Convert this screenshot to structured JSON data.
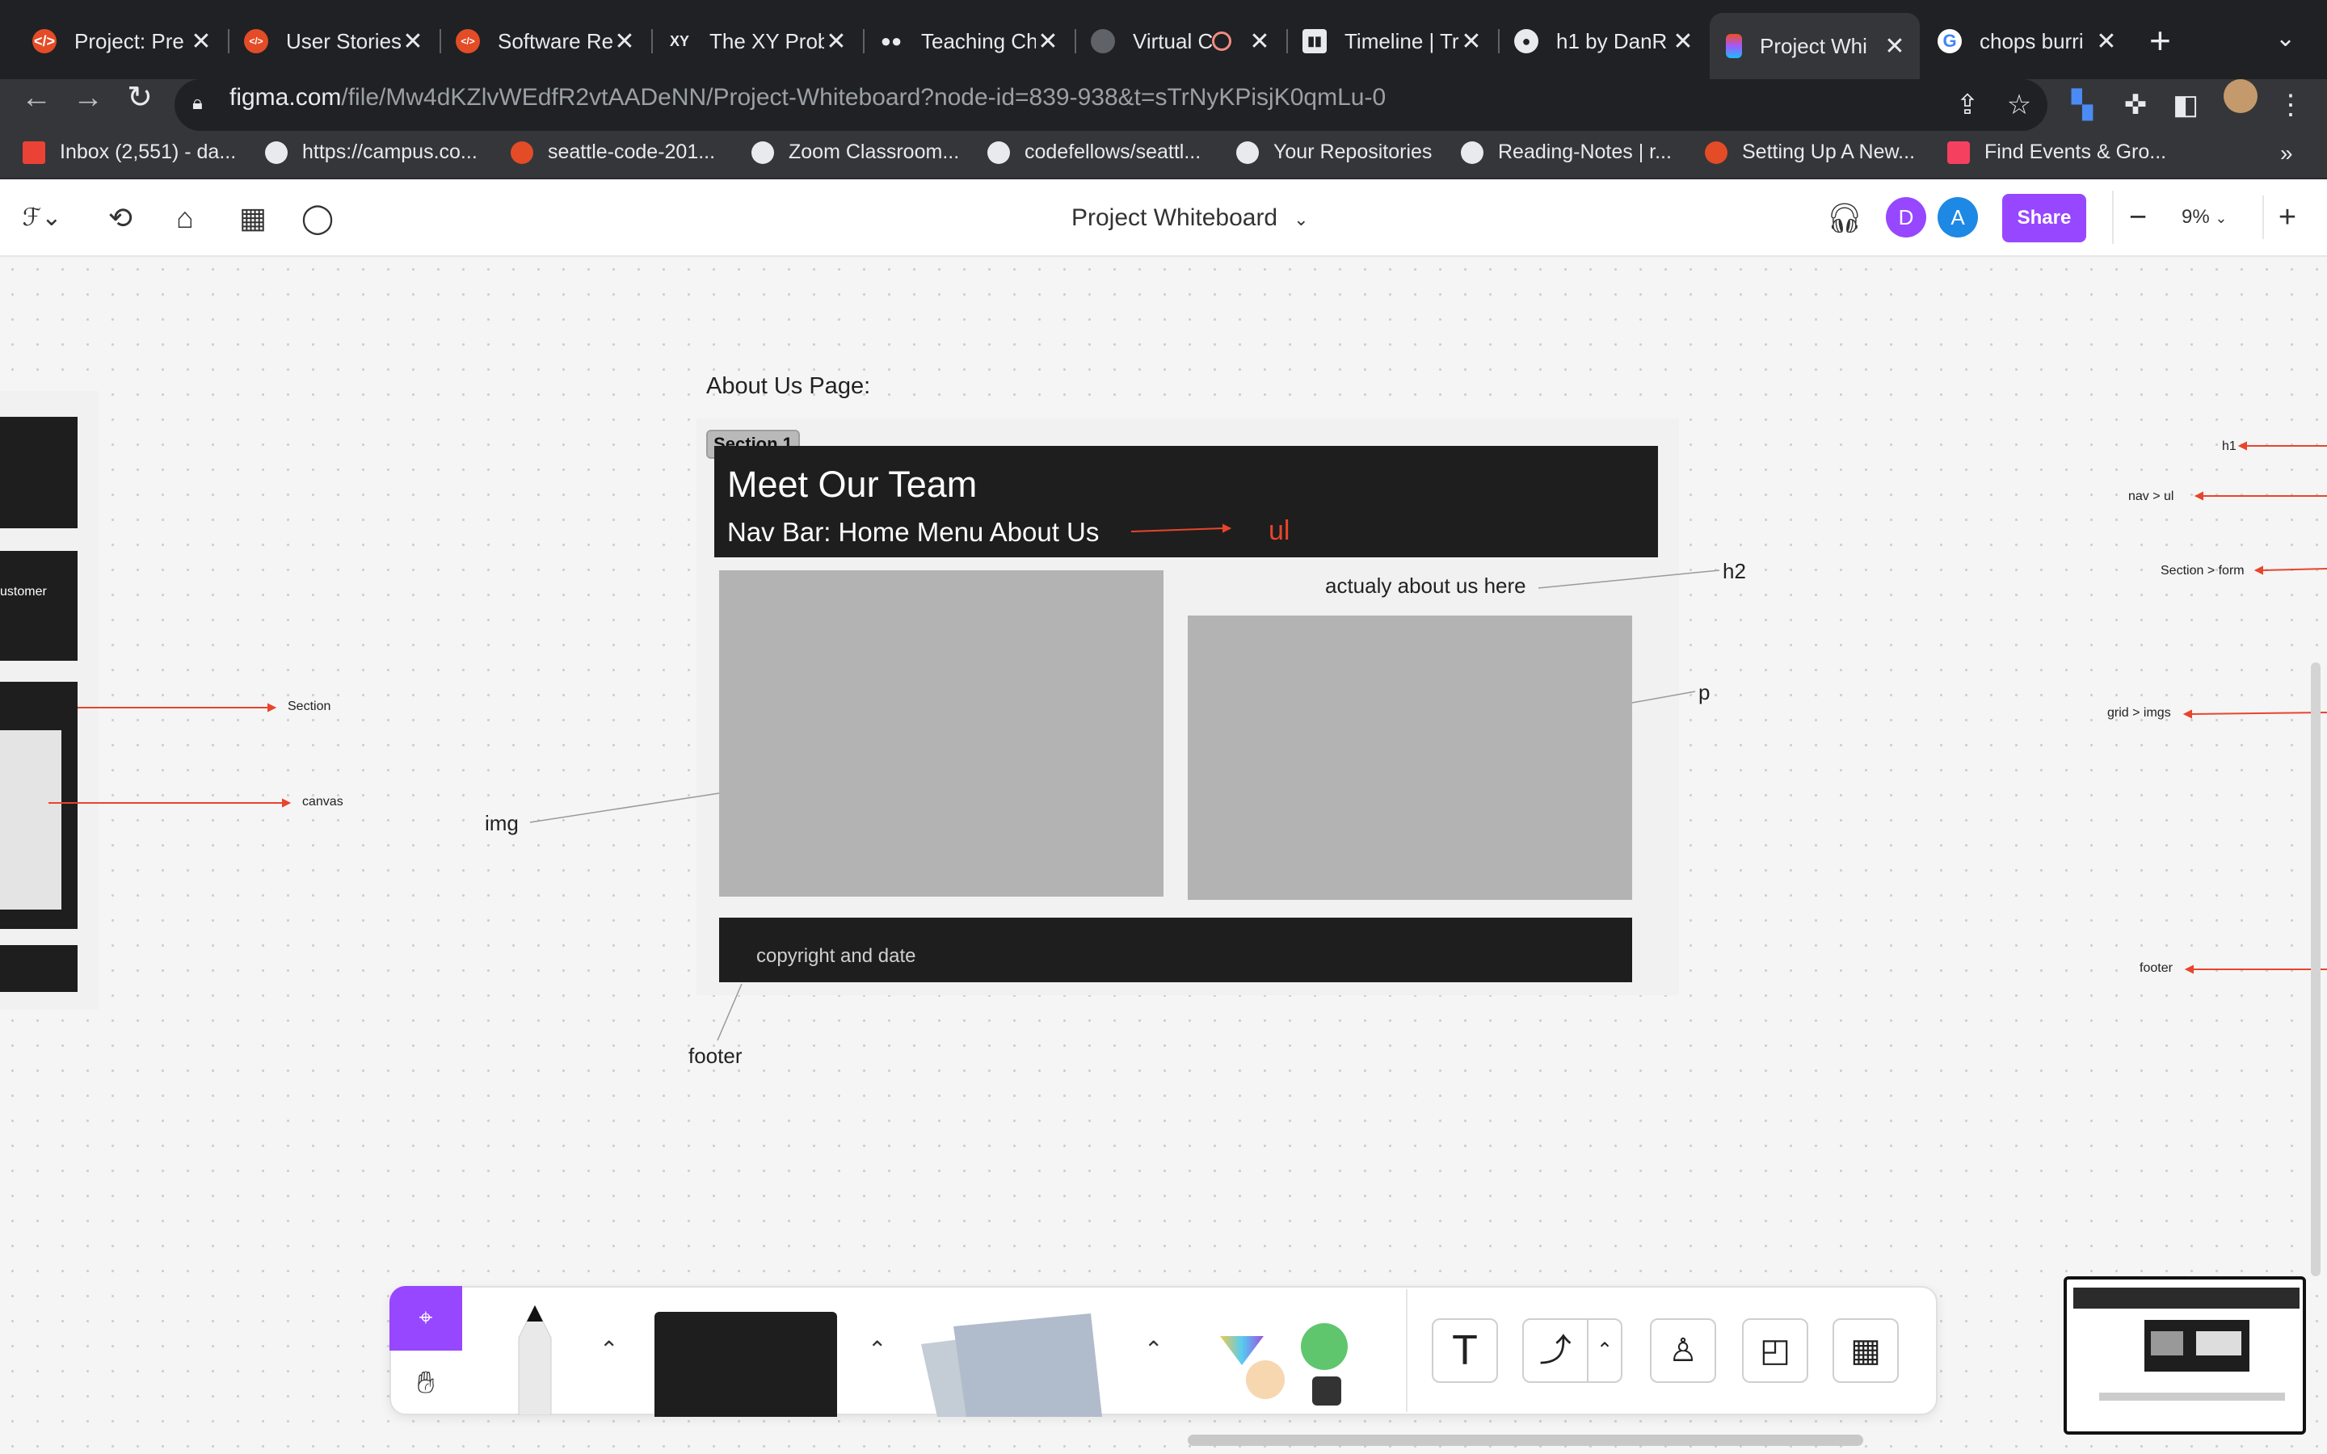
{
  "browser": {
    "tabs": [
      {
        "title": "Project: Pre",
        "favicon": "codefellows-icon",
        "color": "#e34c26"
      },
      {
        "title": "User Stories",
        "favicon": "codefellows-icon",
        "color": "#e34c26"
      },
      {
        "title": "Software Re",
        "favicon": "codefellows-icon",
        "color": "#e34c26"
      },
      {
        "title": "The XY Prob",
        "favicon": "xy-icon",
        "color": "#e8eaed"
      },
      {
        "title": "Teaching Ch",
        "favicon": "medium-icon",
        "color": "#e8eaed"
      },
      {
        "title": "Virtual C",
        "favicon": "globe-icon",
        "color": "#9aa0a6"
      },
      {
        "title": "Timeline | Tr",
        "favicon": "trello-icon",
        "color": "#e8eaed"
      },
      {
        "title": "h1 by DanR",
        "favicon": "github-icon",
        "color": "#e8eaed"
      },
      {
        "title": "Project Whi",
        "favicon": "figma-icon",
        "color": "#a259ff"
      },
      {
        "title": "chops burri",
        "favicon": "google-icon",
        "color": "#4285f4"
      }
    ],
    "url_domain": "figma.com",
    "url_path": "/file/Mw4dKZlvWEdfR2vtAADeNN/Project-Whiteboard?node-id=839-938&t=sTrNyKPisjK0qmLu-0",
    "bookmarks": [
      {
        "label": "Inbox (2,551) - da...",
        "icon": "gmail-icon",
        "color": "#ea4335"
      },
      {
        "label": "https://campus.co...",
        "icon": "globe-icon",
        "color": "#e8eaed"
      },
      {
        "label": "seattle-code-201...",
        "icon": "codefellows-icon",
        "color": "#e34c26"
      },
      {
        "label": "Zoom Classroom...",
        "icon": "globe-icon",
        "color": "#e8eaed"
      },
      {
        "label": "codefellows/seattl...",
        "icon": "github-icon",
        "color": "#e8eaed"
      },
      {
        "label": "Your Repositories",
        "icon": "github-icon",
        "color": "#e8eaed"
      },
      {
        "label": "Reading-Notes | r...",
        "icon": "globe-icon",
        "color": "#e8eaed"
      },
      {
        "label": "Setting Up A New...",
        "icon": "codefellows-icon",
        "color": "#e34c26"
      },
      {
        "label": "Find Events & Gro...",
        "icon": "meetup-icon",
        "color": "#f64060"
      }
    ]
  },
  "figma": {
    "file_title": "Project Whiteboard",
    "share_label": "Share",
    "zoom": "9%",
    "avatars": [
      {
        "letter": "D",
        "color": "#9747ff"
      },
      {
        "letter": "A",
        "color": "#1e88e5"
      }
    ]
  },
  "canvas": {
    "page_title": "About Us Page:",
    "section_tag": "Section 1",
    "header_title": "Meet Our Team",
    "nav_text": "Nav Bar: Home Menu About Us",
    "ul_annotation": "ul",
    "about_text": "actualy about us here",
    "h2_label": "h2",
    "p_label": "p",
    "img_label": "img",
    "footer_text": "copyright and date",
    "footer_label": "footer",
    "left_frame": {
      "customer_text": "ustomer",
      "section_label": "Section",
      "canvas_label": "canvas"
    },
    "right_labels": {
      "h1": "h1",
      "nav_ul": "nav > ul",
      "section_form": "Section > form",
      "grid_imgs": "grid > imgs",
      "footer": "footer"
    },
    "accent_red": "#e8452c"
  }
}
